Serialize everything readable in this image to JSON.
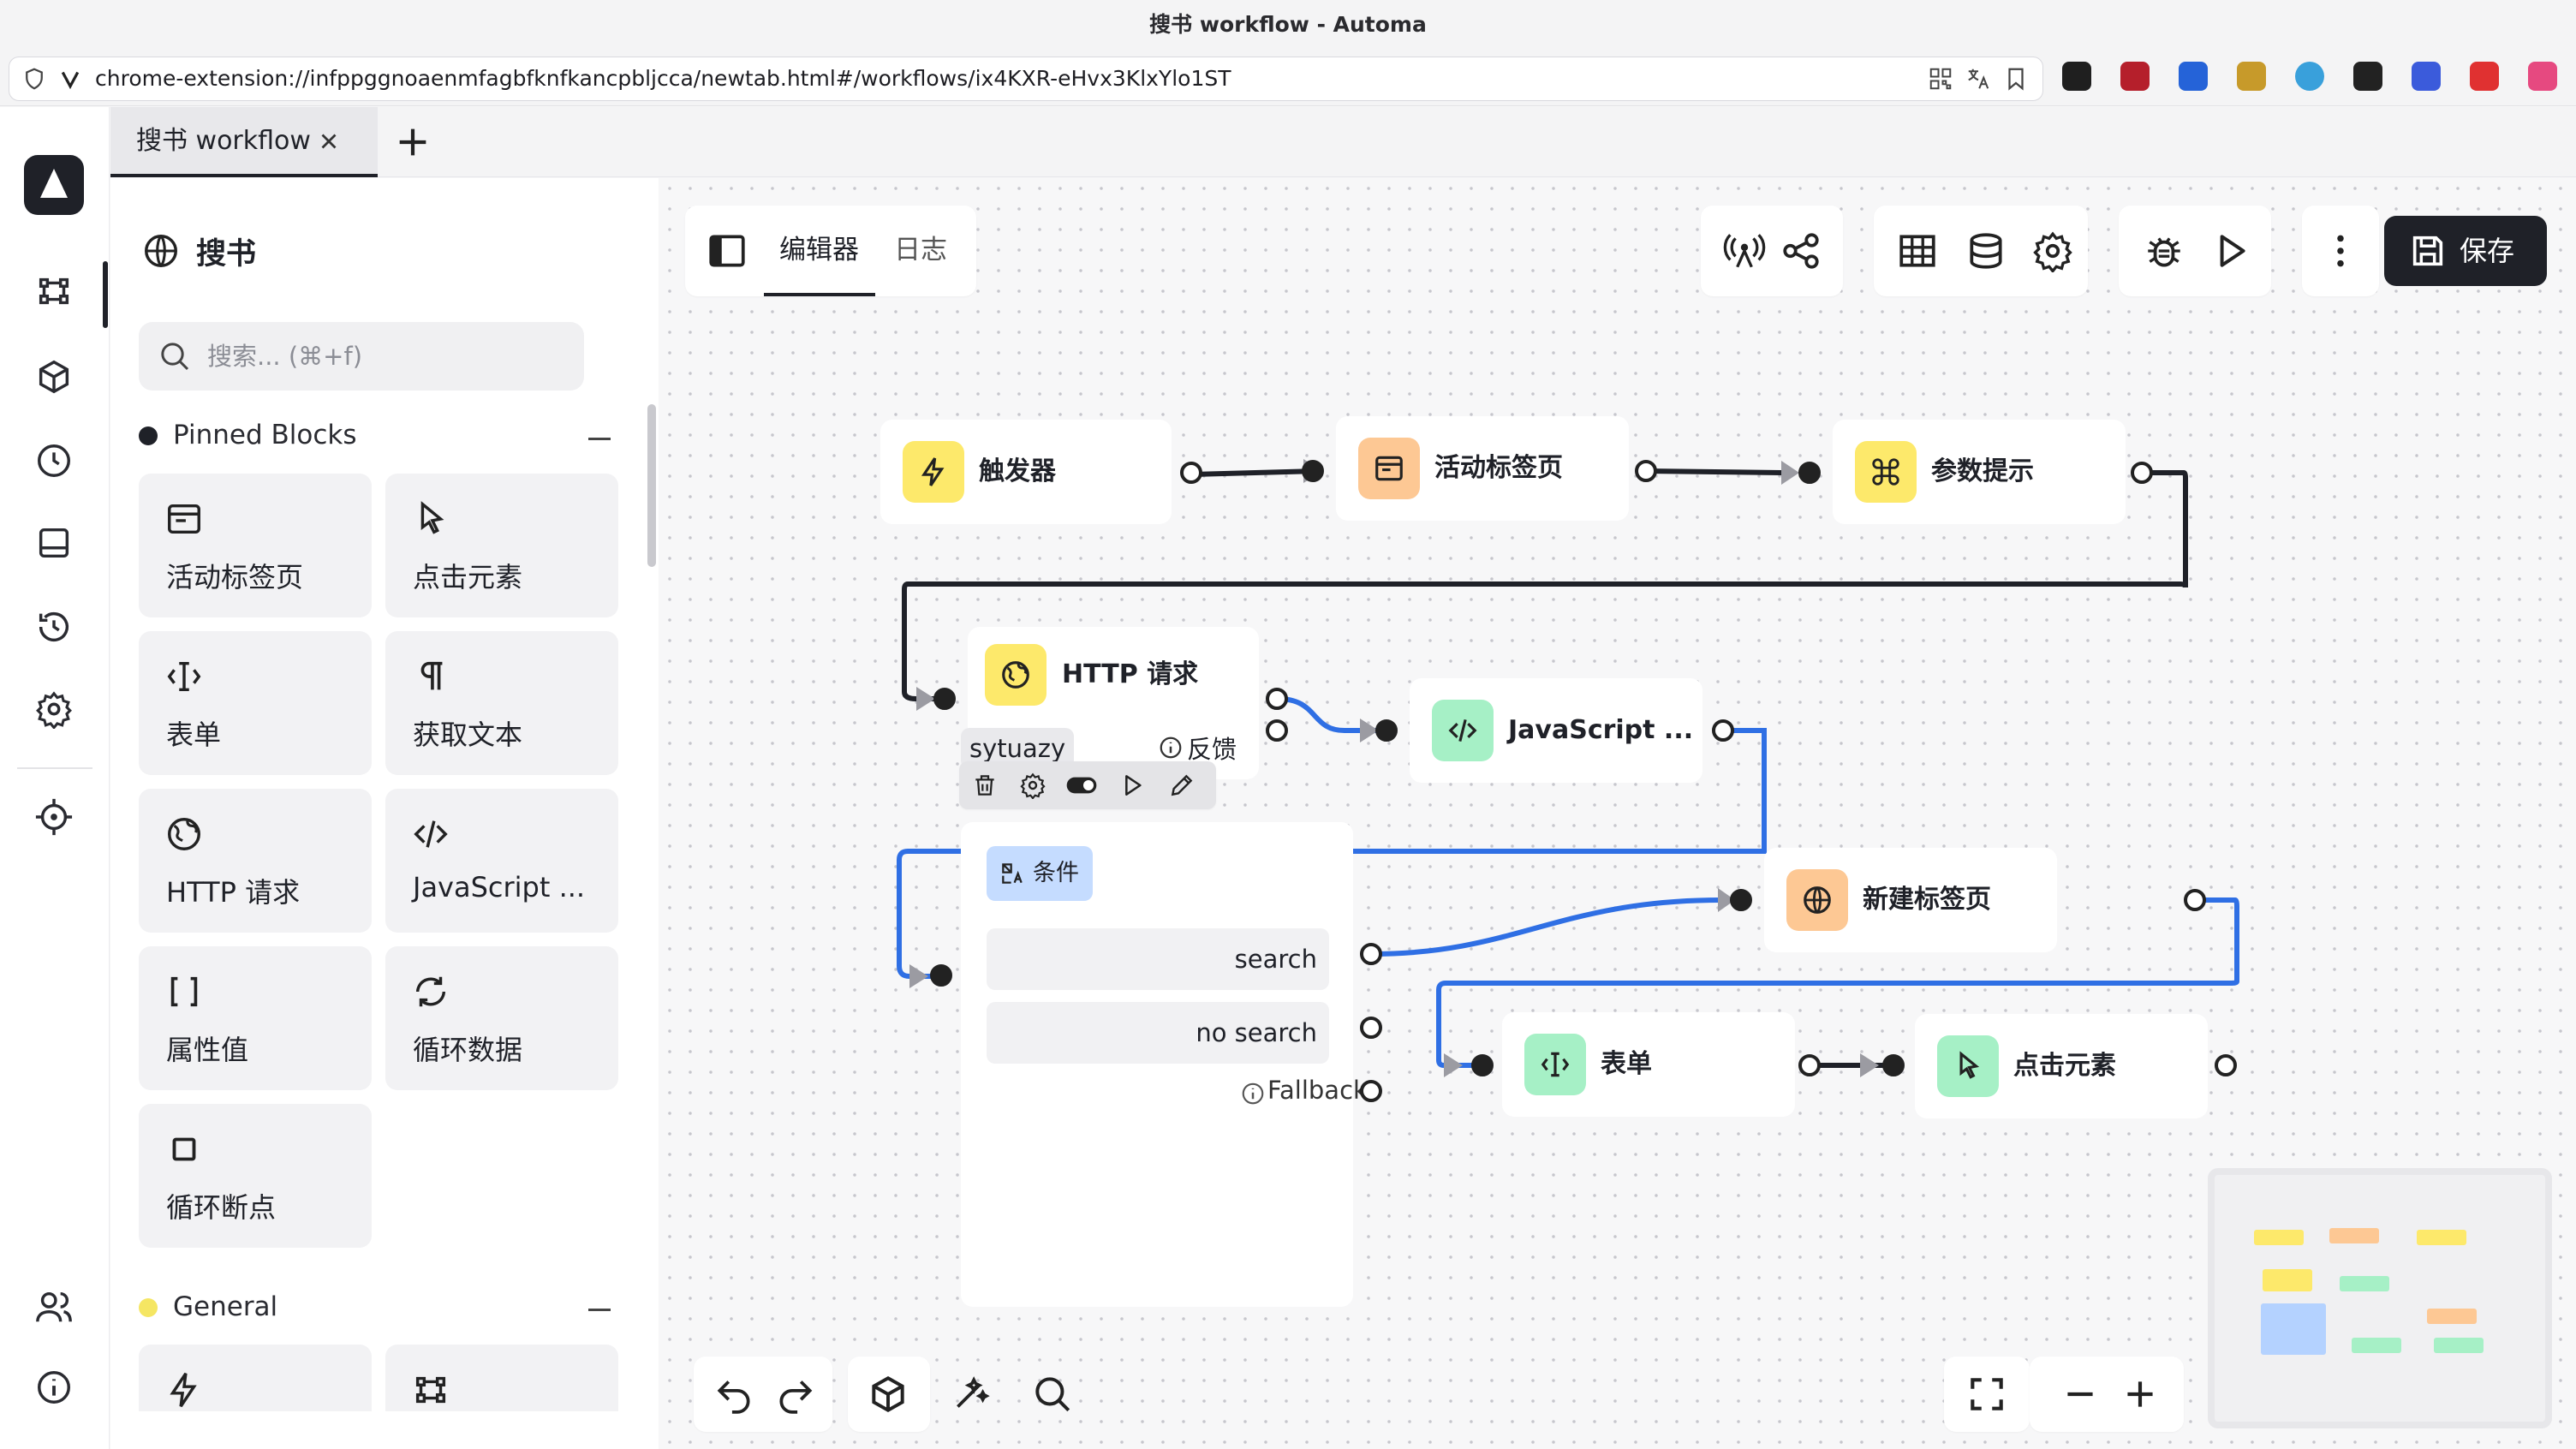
{
  "window": {
    "title": "搜书 workflow - Automa"
  },
  "browser": {
    "url": "chrome-extension://infppggnoaenmfagbfknfkancpbljcca/newtab.html#/workflows/ix4KXR-eHvx3KlxYlo1ST"
  },
  "tabs": [
    {
      "label": "搜书 workflow"
    }
  ],
  "sidebar": {
    "workflow_name": "搜书",
    "search_placeholder": "搜索... (⌘+f)",
    "sections": [
      {
        "title": "Pinned Blocks",
        "color": "#1f2128"
      },
      {
        "title": "General",
        "color": "#f5e663"
      }
    ],
    "pinned_blocks": [
      {
        "label": "活动标签页",
        "icon": "browser-window-icon"
      },
      {
        "label": "点击元素",
        "icon": "cursor-click-icon"
      },
      {
        "label": "表单",
        "icon": "text-cursor-icon"
      },
      {
        "label": "获取文本",
        "icon": "paragraph-icon"
      },
      {
        "label": "HTTP 请求",
        "icon": "globe-icon"
      },
      {
        "label": "JavaScript ...",
        "icon": "code-icon"
      },
      {
        "label": "属性值",
        "icon": "brackets-icon"
      },
      {
        "label": "循环数据",
        "icon": "loop-icon"
      },
      {
        "label": "循环断点",
        "icon": "square-icon"
      }
    ]
  },
  "editor": {
    "tabs": [
      {
        "label": "编辑器",
        "active": true
      },
      {
        "label": "日志",
        "active": false
      }
    ],
    "save_label": "保存"
  },
  "nodes": {
    "trigger": {
      "label": "触发器",
      "color": "#fde96b"
    },
    "active_tab": {
      "label": "活动标签页",
      "color": "#fdc894"
    },
    "param_prompt": {
      "label": "参数提示",
      "color": "#fde96b"
    },
    "http": {
      "label": "HTTP 请求",
      "color": "#fde96b",
      "tag": "sytuazy",
      "feedback": "反馈"
    },
    "javascript": {
      "label": "JavaScript ...",
      "color": "#a6f0c6"
    },
    "condition": {
      "label": "条件",
      "color": "#c5dcff",
      "rows": [
        "search",
        "no search"
      ],
      "fallback": "Fallback"
    },
    "new_tab": {
      "label": "新建标签页",
      "color": "#fdc894"
    },
    "form": {
      "label": "表单",
      "color": "#a6f0c6"
    },
    "click": {
      "label": "点击元素",
      "color": "#a6f0c6"
    }
  },
  "colors": {
    "edge_dark": "#1f2128",
    "edge_blue": "#2f6fe4",
    "accent": "#1f2128"
  }
}
